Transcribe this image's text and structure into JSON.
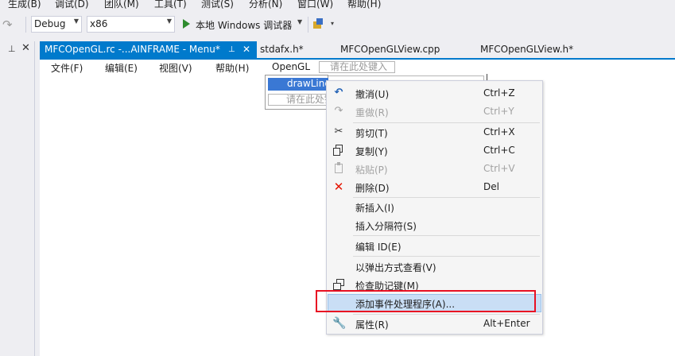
{
  "main_menu": [
    "生成(B)",
    "调试(D)",
    "团队(M)",
    "工具(T)",
    "测试(S)",
    "分析(N)",
    "窗口(W)",
    "帮助(H)"
  ],
  "toolbar": {
    "config": "Debug",
    "platform": "x86",
    "run_label": "本地 Windows 调试器"
  },
  "tabs": {
    "active": "MFCOpenGL.rc -...AINFRAME - Menu*",
    "others": [
      "stdafx.h*",
      "MFCOpenGLView.cpp",
      "MFCOpenGLView.h*"
    ]
  },
  "resource_menu": {
    "items": [
      "文件(F)",
      "编辑(E)",
      "视图(V)",
      "帮助(H)",
      "OpenGL"
    ],
    "new_item_placeholder": "请在此处键入",
    "dropdown_selected": "drawLine",
    "dropdown_placeholder": "请在此处键入"
  },
  "context_menu": {
    "items": [
      {
        "icon": "undo-icon",
        "label": "撤消(U)",
        "shortcut": "Ctrl+Z"
      },
      {
        "icon": "redo-icon",
        "label": "重做(R)",
        "shortcut": "Ctrl+Y"
      },
      {
        "icon": "cut-icon",
        "label": "剪切(T)",
        "shortcut": "Ctrl+X"
      },
      {
        "icon": "copy-icon",
        "label": "复制(Y)",
        "shortcut": "Ctrl+C"
      },
      {
        "icon": "paste-icon",
        "label": "粘贴(P)",
        "shortcut": "Ctrl+V"
      },
      {
        "icon": "delete-icon",
        "label": "删除(D)",
        "shortcut": "Del"
      },
      {
        "icon": "",
        "label": "新插入(I)",
        "shortcut": ""
      },
      {
        "icon": "",
        "label": "插入分隔符(S)",
        "shortcut": ""
      },
      {
        "icon": "",
        "label": "编辑 ID(E)",
        "shortcut": ""
      },
      {
        "icon": "",
        "label": "以弹出方式查看(V)",
        "shortcut": ""
      },
      {
        "icon": "check-mnemonics-icon",
        "label": "检查助记键(M)",
        "shortcut": ""
      },
      {
        "icon": "",
        "label": "添加事件处理程序(A)...",
        "shortcut": ""
      },
      {
        "icon": "wrench-icon",
        "label": "属性(R)",
        "shortcut": "Alt+Enter"
      }
    ]
  },
  "colors": {
    "accent": "#007acc",
    "highlight": "#c9def5",
    "callout": "#e81123",
    "delete": "#e51400",
    "undo": "#1e5fb4"
  }
}
